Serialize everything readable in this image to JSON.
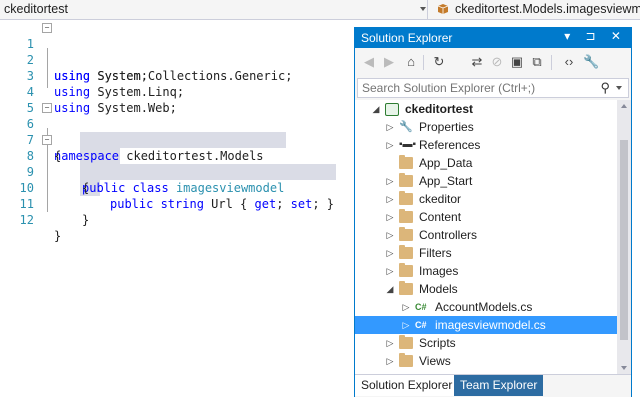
{
  "navbar": {
    "project": "ckeditortest",
    "type": "ckeditortest.Models.imagesviewmo"
  },
  "editor": {
    "line_numbers": [
      "1",
      "2",
      "3",
      "4",
      "5",
      "6",
      "7",
      "8",
      "9",
      "10",
      "11",
      "12"
    ],
    "lines": [
      {
        "kw": "using",
        "rest": " System;"
      },
      {
        "kw": "using",
        "rest": " System.Collections.Generic;"
      },
      {
        "kw": "using",
        "rest": " System.Linq;"
      },
      {
        "kw": "using",
        "rest": " System.Web;"
      },
      {
        "kw": "",
        "rest": ""
      },
      {
        "kw": "namespace",
        "rest": " ckeditortest.Models"
      },
      {
        "kw": "",
        "rest": "{"
      },
      {
        "kw": "public class",
        "type": "imagesviewmodel"
      },
      {
        "kw": "",
        "rest": "{"
      },
      {
        "kw": "public string",
        "rest": " Url { ",
        "kw2": "get",
        "mid": "; ",
        "kw3": "set",
        "end": "; }"
      },
      {
        "kw": "",
        "rest": "}"
      },
      {
        "kw": "",
        "rest": "}"
      }
    ]
  },
  "solution_explorer": {
    "title": "Solution Explorer",
    "title_icons": [
      "pin-icon",
      "close-icon"
    ],
    "title_glyphs": "▾ ⊐ ✕",
    "search_placeholder": "Search Solution Explorer (Ctrl+;)",
    "toolbar_glyphs": [
      "◀",
      "▶",
      "⌂",
      "↻",
      "⇄",
      "⊘",
      "▣",
      "⧉",
      "‹›",
      "🔧"
    ],
    "tree": [
      {
        "label": "ckeditortest",
        "icon": "project-icon",
        "expander": "◢",
        "bold": true
      },
      {
        "label": "Properties",
        "icon": "wrench-icon",
        "expander": "▷"
      },
      {
        "label": "References",
        "icon": "references-icon",
        "expander": "▷"
      },
      {
        "label": "App_Data",
        "icon": "folder-icon",
        "expander": ""
      },
      {
        "label": "App_Start",
        "icon": "folder-icon",
        "expander": "▷"
      },
      {
        "label": "ckeditor",
        "icon": "folder-icon",
        "expander": "▷"
      },
      {
        "label": "Content",
        "icon": "folder-icon",
        "expander": "▷"
      },
      {
        "label": "Controllers",
        "icon": "folder-icon",
        "expander": "▷"
      },
      {
        "label": "Filters",
        "icon": "folder-icon",
        "expander": "▷"
      },
      {
        "label": "Images",
        "icon": "folder-icon",
        "expander": "▷"
      },
      {
        "label": "Models",
        "icon": "folder-icon",
        "expander": "◢"
      },
      {
        "label": "AccountModels.cs",
        "icon": "csharp-file-icon",
        "expander": "▷"
      },
      {
        "label": "imagesviewmodel.cs",
        "icon": "csharp-file-icon",
        "expander": "▷",
        "selected": true
      },
      {
        "label": "Scripts",
        "icon": "folder-icon",
        "expander": "▷"
      },
      {
        "label": "Views",
        "icon": "folder-icon",
        "expander": "▷"
      }
    ],
    "tabs": [
      "Solution Explorer",
      "Team Explorer"
    ]
  },
  "colors": {
    "accent": "#007acc",
    "keyword": "#0000ff",
    "type": "#2b91af",
    "selection": "#3399ff",
    "folder": "#dcb67a",
    "csharp": "#388a34"
  }
}
